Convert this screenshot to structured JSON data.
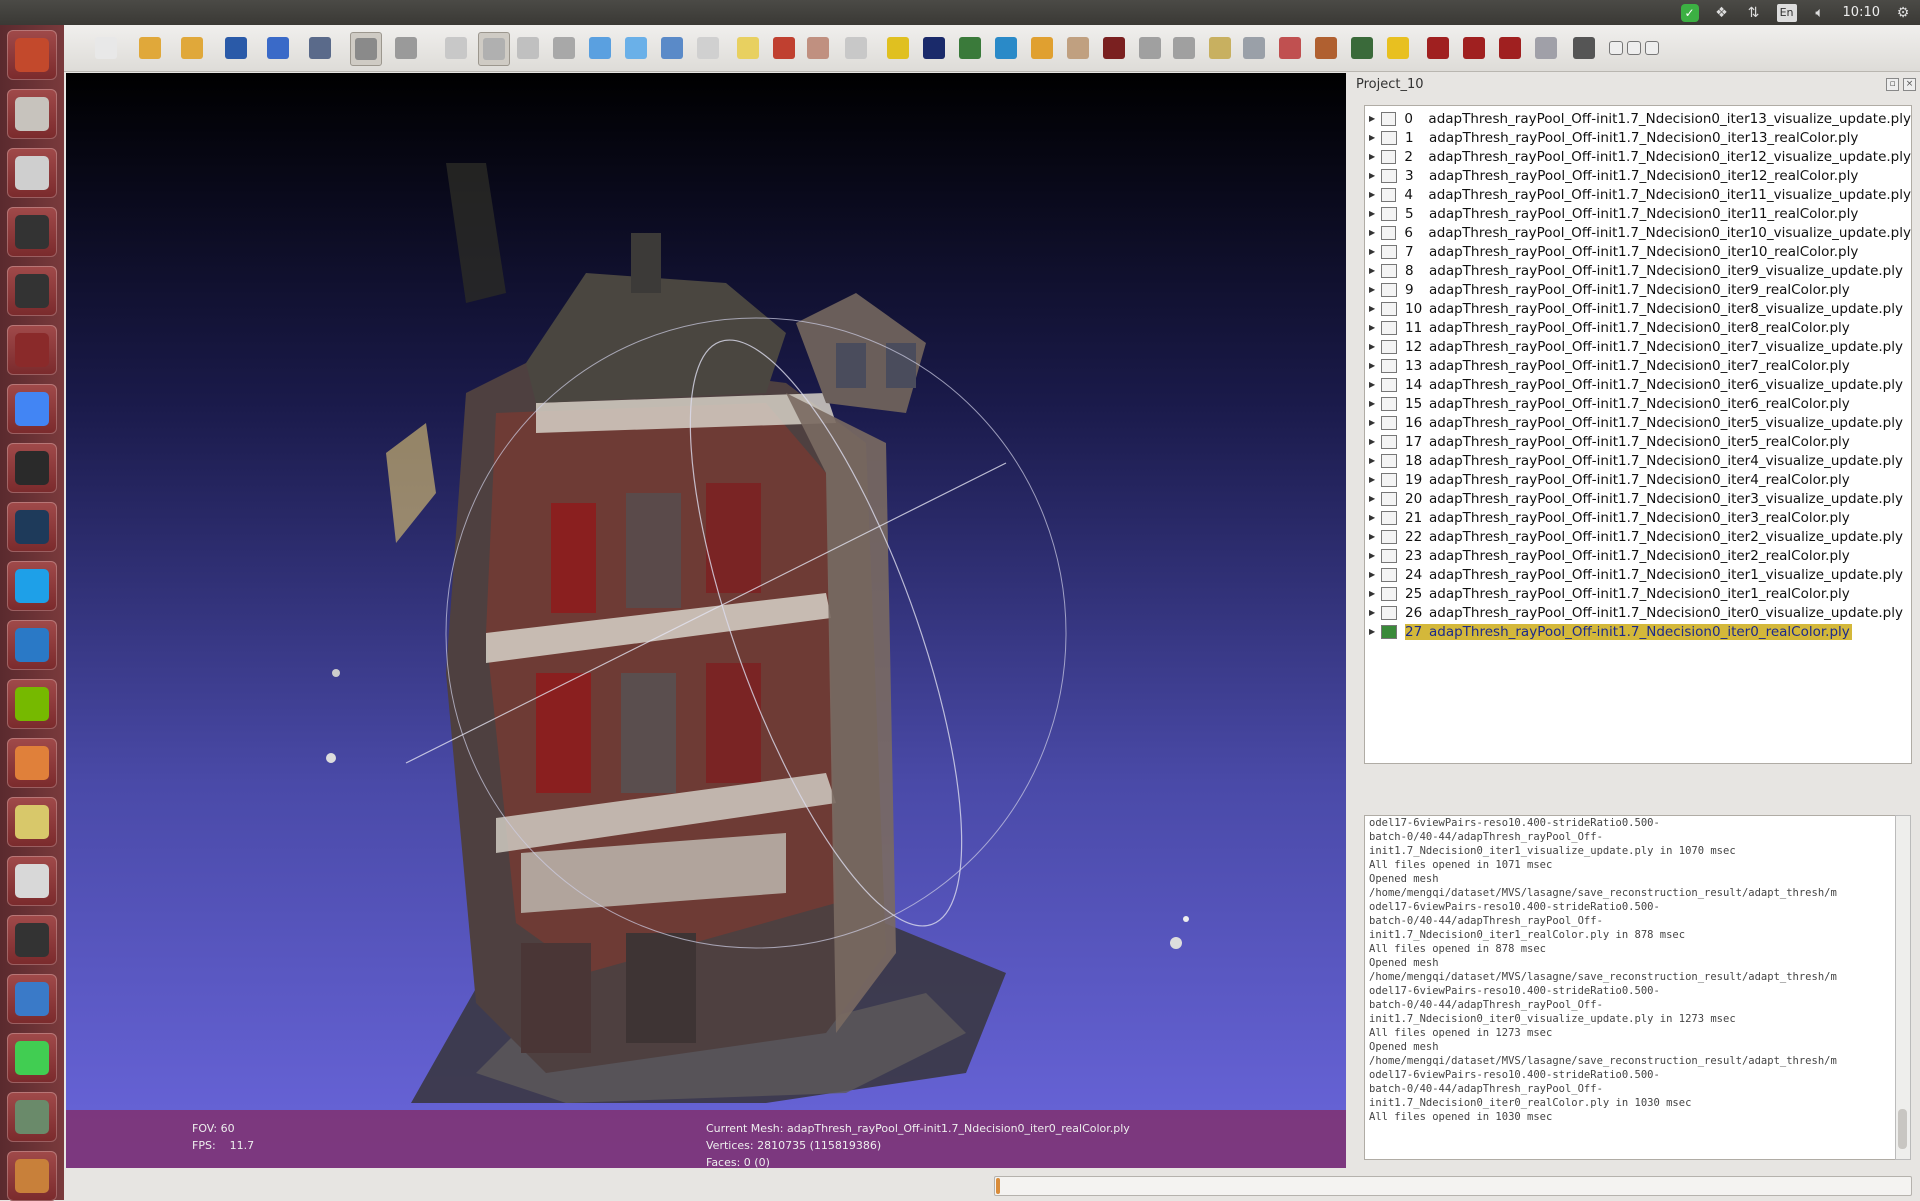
{
  "system_bar": {
    "clock": "10:10",
    "language": "En",
    "tray_icons": [
      "update-check-icon",
      "dropbox-icon",
      "network-updown-icon",
      "keyboard-lang-icon",
      "volume-icon",
      "gear-icon"
    ]
  },
  "launcher": {
    "items": [
      {
        "name": "ubuntu-dash-icon",
        "color": "#c3492c"
      },
      {
        "name": "file-manager-icon",
        "color": "#c7c3bd"
      },
      {
        "name": "drive-icon",
        "color": "#cfcfcf"
      },
      {
        "name": "device-phone-icon",
        "color": "#333333"
      },
      {
        "name": "device-phone-2-icon",
        "color": "#333333"
      },
      {
        "name": "window-switcher-icon",
        "color": "#8a2a2a"
      },
      {
        "name": "chrome-icon",
        "color": "#4285f4"
      },
      {
        "name": "terminal-icon",
        "color": "#2a2a2a"
      },
      {
        "name": "system-monitor-icon",
        "color": "#1e3a5a"
      },
      {
        "name": "skype-icon",
        "color": "#1ea0e8"
      },
      {
        "name": "vscode-icon",
        "color": "#2a79c6"
      },
      {
        "name": "nvidia-icon",
        "color": "#76b900"
      },
      {
        "name": "matlab-icon",
        "color": "#e0803a"
      },
      {
        "name": "image-viewer-icon",
        "color": "#d8c86a"
      },
      {
        "name": "text-editor-icon",
        "color": "#d8d8d8"
      },
      {
        "name": "device-phone-3-icon",
        "color": "#333333"
      },
      {
        "name": "blender-icon",
        "color": "#3a7ac8"
      },
      {
        "name": "qt-creator-icon",
        "color": "#41cd52"
      },
      {
        "name": "eye-app-icon",
        "color": "#6a8a6a"
      },
      {
        "name": "software-center-icon",
        "color": "#c8803a"
      }
    ]
  },
  "toolbar": {
    "buttons": [
      "new-project-icon",
      "open-project-icon",
      "import-mesh-icon",
      "reload-icon",
      "export-mesh-icon",
      "snapshot-icon",
      "show-layers-icon",
      "raster-icon",
      "bbox-icon",
      "points-icon",
      "wireframe-icon",
      "hidden-lines-icon",
      "flat-icon",
      "flat-lines-icon",
      "smooth-icon",
      "texture-icon",
      "light-icon",
      "backface-icon",
      "double-side-icon",
      "trackball-icon",
      "lambda-icon",
      "shader-icon",
      "color-icon",
      "axis-icon",
      "paint-icon",
      "brush-icon",
      "p-icon",
      "select-vertex-icon",
      "select-face-icon",
      "fit-icon",
      "measure-icon",
      "align-icon",
      "pick-icon",
      "georef-icon",
      "info-icon",
      "delete-vertex-icon",
      "delete-face-icon",
      "delete-all-icon",
      "zoom-icon",
      "eye-toggle-icon",
      "window-min-icon",
      "window-restore-icon",
      "window-close-icon"
    ]
  },
  "viewport": {
    "fov_label": "FOV: 60",
    "fps_label": "FPS:",
    "fps_value": "11.7",
    "current_mesh": "Current Mesh: adapThresh_rayPool_Off-init1.7_Ndecision0_iter0_realColor.ply",
    "vertices": "Vertices: 2810735 (115819386)",
    "faces": "Faces: 0 (0)"
  },
  "panel": {
    "title": "Project_10",
    "layers": [
      {
        "num": "0",
        "name": "adapThresh_rayPool_Off-init1.7_Ndecision0_iter13_visualize_update.ply"
      },
      {
        "num": "1",
        "name": "adapThresh_rayPool_Off-init1.7_Ndecision0_iter13_realColor.ply"
      },
      {
        "num": "2",
        "name": "adapThresh_rayPool_Off-init1.7_Ndecision0_iter12_visualize_update.ply"
      },
      {
        "num": "3",
        "name": "adapThresh_rayPool_Off-init1.7_Ndecision0_iter12_realColor.ply"
      },
      {
        "num": "4",
        "name": "adapThresh_rayPool_Off-init1.7_Ndecision0_iter11_visualize_update.ply"
      },
      {
        "num": "5",
        "name": "adapThresh_rayPool_Off-init1.7_Ndecision0_iter11_realColor.ply"
      },
      {
        "num": "6",
        "name": "adapThresh_rayPool_Off-init1.7_Ndecision0_iter10_visualize_update.ply"
      },
      {
        "num": "7",
        "name": "adapThresh_rayPool_Off-init1.7_Ndecision0_iter10_realColor.ply"
      },
      {
        "num": "8",
        "name": "adapThresh_rayPool_Off-init1.7_Ndecision0_iter9_visualize_update.ply"
      },
      {
        "num": "9",
        "name": "adapThresh_rayPool_Off-init1.7_Ndecision0_iter9_realColor.ply"
      },
      {
        "num": "10",
        "name": "adapThresh_rayPool_Off-init1.7_Ndecision0_iter8_visualize_update.ply"
      },
      {
        "num": "11",
        "name": "adapThresh_rayPool_Off-init1.7_Ndecision0_iter8_realColor.ply"
      },
      {
        "num": "12",
        "name": "adapThresh_rayPool_Off-init1.7_Ndecision0_iter7_visualize_update.ply"
      },
      {
        "num": "13",
        "name": "adapThresh_rayPool_Off-init1.7_Ndecision0_iter7_realColor.ply"
      },
      {
        "num": "14",
        "name": "adapThresh_rayPool_Off-init1.7_Ndecision0_iter6_visualize_update.ply"
      },
      {
        "num": "15",
        "name": "adapThresh_rayPool_Off-init1.7_Ndecision0_iter6_realColor.ply"
      },
      {
        "num": "16",
        "name": "adapThresh_rayPool_Off-init1.7_Ndecision0_iter5_visualize_update.ply"
      },
      {
        "num": "17",
        "name": "adapThresh_rayPool_Off-init1.7_Ndecision0_iter5_realColor.ply"
      },
      {
        "num": "18",
        "name": "adapThresh_rayPool_Off-init1.7_Ndecision0_iter4_visualize_update.ply"
      },
      {
        "num": "19",
        "name": "adapThresh_rayPool_Off-init1.7_Ndecision0_iter4_realColor.ply"
      },
      {
        "num": "20",
        "name": "adapThresh_rayPool_Off-init1.7_Ndecision0_iter3_visualize_update.ply"
      },
      {
        "num": "21",
        "name": "adapThresh_rayPool_Off-init1.7_Ndecision0_iter3_realColor.ply"
      },
      {
        "num": "22",
        "name": "adapThresh_rayPool_Off-init1.7_Ndecision0_iter2_visualize_update.ply"
      },
      {
        "num": "23",
        "name": "adapThresh_rayPool_Off-init1.7_Ndecision0_iter2_realColor.ply"
      },
      {
        "num": "24",
        "name": "adapThresh_rayPool_Off-init1.7_Ndecision0_iter1_visualize_update.ply"
      },
      {
        "num": "25",
        "name": "adapThresh_rayPool_Off-init1.7_Ndecision0_iter1_realColor.ply"
      },
      {
        "num": "26",
        "name": "adapThresh_rayPool_Off-init1.7_Ndecision0_iter0_visualize_update.ply"
      },
      {
        "num": "27",
        "name": "adapThresh_rayPool_Off-init1.7_Ndecision0_iter0_realColor.ply",
        "selected": true
      }
    ]
  },
  "log": {
    "lines": [
      "odel17-6viewPairs-reso10.400-strideRatio0.500-",
      "batch-0/40-44/adapThresh_rayPool_Off-",
      "init1.7_Ndecision0_iter1_visualize_update.ply in 1070 msec",
      "All files opened in 1071 msec",
      "Opened mesh",
      "/home/mengqi/dataset/MVS/lasagne/save_reconstruction_result/adapt_thresh/m",
      "odel17-6viewPairs-reso10.400-strideRatio0.500-",
      "batch-0/40-44/adapThresh_rayPool_Off-",
      "init1.7_Ndecision0_iter1_realColor.ply in 878 msec",
      "All files opened in 878 msec",
      "Opened mesh",
      "/home/mengqi/dataset/MVS/lasagne/save_reconstruction_result/adapt_thresh/m",
      "odel17-6viewPairs-reso10.400-strideRatio0.500-",
      "batch-0/40-44/adapThresh_rayPool_Off-",
      "init1.7_Ndecision0_iter0_visualize_update.ply in 1273 msec",
      "All files opened in 1273 msec",
      "Opened mesh",
      "/home/mengqi/dataset/MVS/lasagne/save_reconstruction_result/adapt_thresh/m",
      "odel17-6viewPairs-reso10.400-strideRatio0.500-",
      "batch-0/40-44/adapThresh_rayPool_Off-",
      "init1.7_Ndecision0_iter0_realColor.ply in 1030 msec",
      "All files opened in 1030 msec"
    ]
  },
  "progress": {
    "fraction": 0.004,
    "color": "#d98c3a"
  },
  "colors": {
    "selection": "#d4b83a",
    "selection_text": "#1c2a8a",
    "hud": "#80306e",
    "launcher": "#6a3034"
  }
}
